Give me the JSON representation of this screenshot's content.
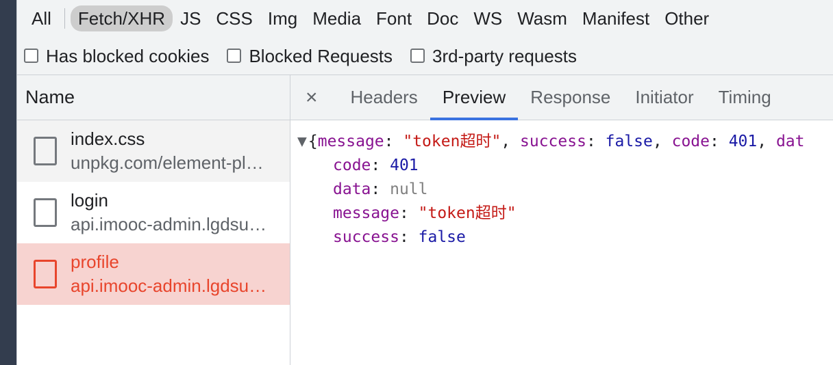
{
  "filter_bar": {
    "resource_types": [
      {
        "label": "All",
        "active": false
      },
      {
        "label": "Fetch/XHR",
        "active": true
      },
      {
        "label": "JS",
        "active": false
      },
      {
        "label": "CSS",
        "active": false
      },
      {
        "label": "Img",
        "active": false
      },
      {
        "label": "Media",
        "active": false
      },
      {
        "label": "Font",
        "active": false
      },
      {
        "label": "Doc",
        "active": false
      },
      {
        "label": "WS",
        "active": false
      },
      {
        "label": "Wasm",
        "active": false
      },
      {
        "label": "Manifest",
        "active": false
      },
      {
        "label": "Other",
        "active": false
      }
    ],
    "checkboxes": [
      {
        "label": "Has blocked cookies",
        "checked": false
      },
      {
        "label": "Blocked Requests",
        "checked": false
      },
      {
        "label": "3rd-party requests",
        "checked": false
      }
    ]
  },
  "request_list": {
    "column_header": "Name",
    "rows": [
      {
        "name": "index.css",
        "domain": "unpkg.com/element-pl…",
        "status": "ok",
        "icon": "file-icon"
      },
      {
        "name": "login",
        "domain": "api.imooc-admin.lgdsu…",
        "status": "ok",
        "icon": "file-icon"
      },
      {
        "name": "profile",
        "domain": "api.imooc-admin.lgdsu…",
        "status": "error",
        "icon": "file-icon"
      }
    ]
  },
  "detail_panel": {
    "close_label": "×",
    "tabs": [
      {
        "label": "Headers",
        "active": false
      },
      {
        "label": "Preview",
        "active": true
      },
      {
        "label": "Response",
        "active": false
      },
      {
        "label": "Initiator",
        "active": false
      },
      {
        "label": "Timing",
        "active": false
      }
    ],
    "preview": {
      "caret": "▼",
      "summary": {
        "open_brace": "{",
        "parts": [
          {
            "text": "message",
            "kind": "key"
          },
          {
            "text": ": ",
            "kind": "punct"
          },
          {
            "text": "\"token超时\"",
            "kind": "string"
          },
          {
            "text": ", ",
            "kind": "punct"
          },
          {
            "text": "success",
            "kind": "key"
          },
          {
            "text": ": ",
            "kind": "punct"
          },
          {
            "text": "false",
            "kind": "bool"
          },
          {
            "text": ", ",
            "kind": "punct"
          },
          {
            "text": "code",
            "kind": "key"
          },
          {
            "text": ": ",
            "kind": "punct"
          },
          {
            "text": "401",
            "kind": "number"
          },
          {
            "text": ", ",
            "kind": "punct"
          },
          {
            "text": "dat",
            "kind": "key"
          }
        ]
      },
      "properties": [
        {
          "key": "code",
          "value": "401",
          "kind": "number"
        },
        {
          "key": "data",
          "value": "null",
          "kind": "null"
        },
        {
          "key": "message",
          "value": "\"token超时\"",
          "kind": "string"
        },
        {
          "key": "success",
          "value": "false",
          "kind": "bool"
        }
      ]
    }
  },
  "colors": {
    "rail": "#333d4e",
    "toolbar_bg": "#f1f3f4",
    "active_pill": "#cdcdcd",
    "active_tab_underline": "#3a72e0",
    "error_row_bg": "#f7d3d0",
    "error_text": "#e8452c",
    "json_key": "#881391",
    "json_number": "#1a1aa6",
    "json_string": "#c41a16",
    "json_null": "#808080"
  }
}
